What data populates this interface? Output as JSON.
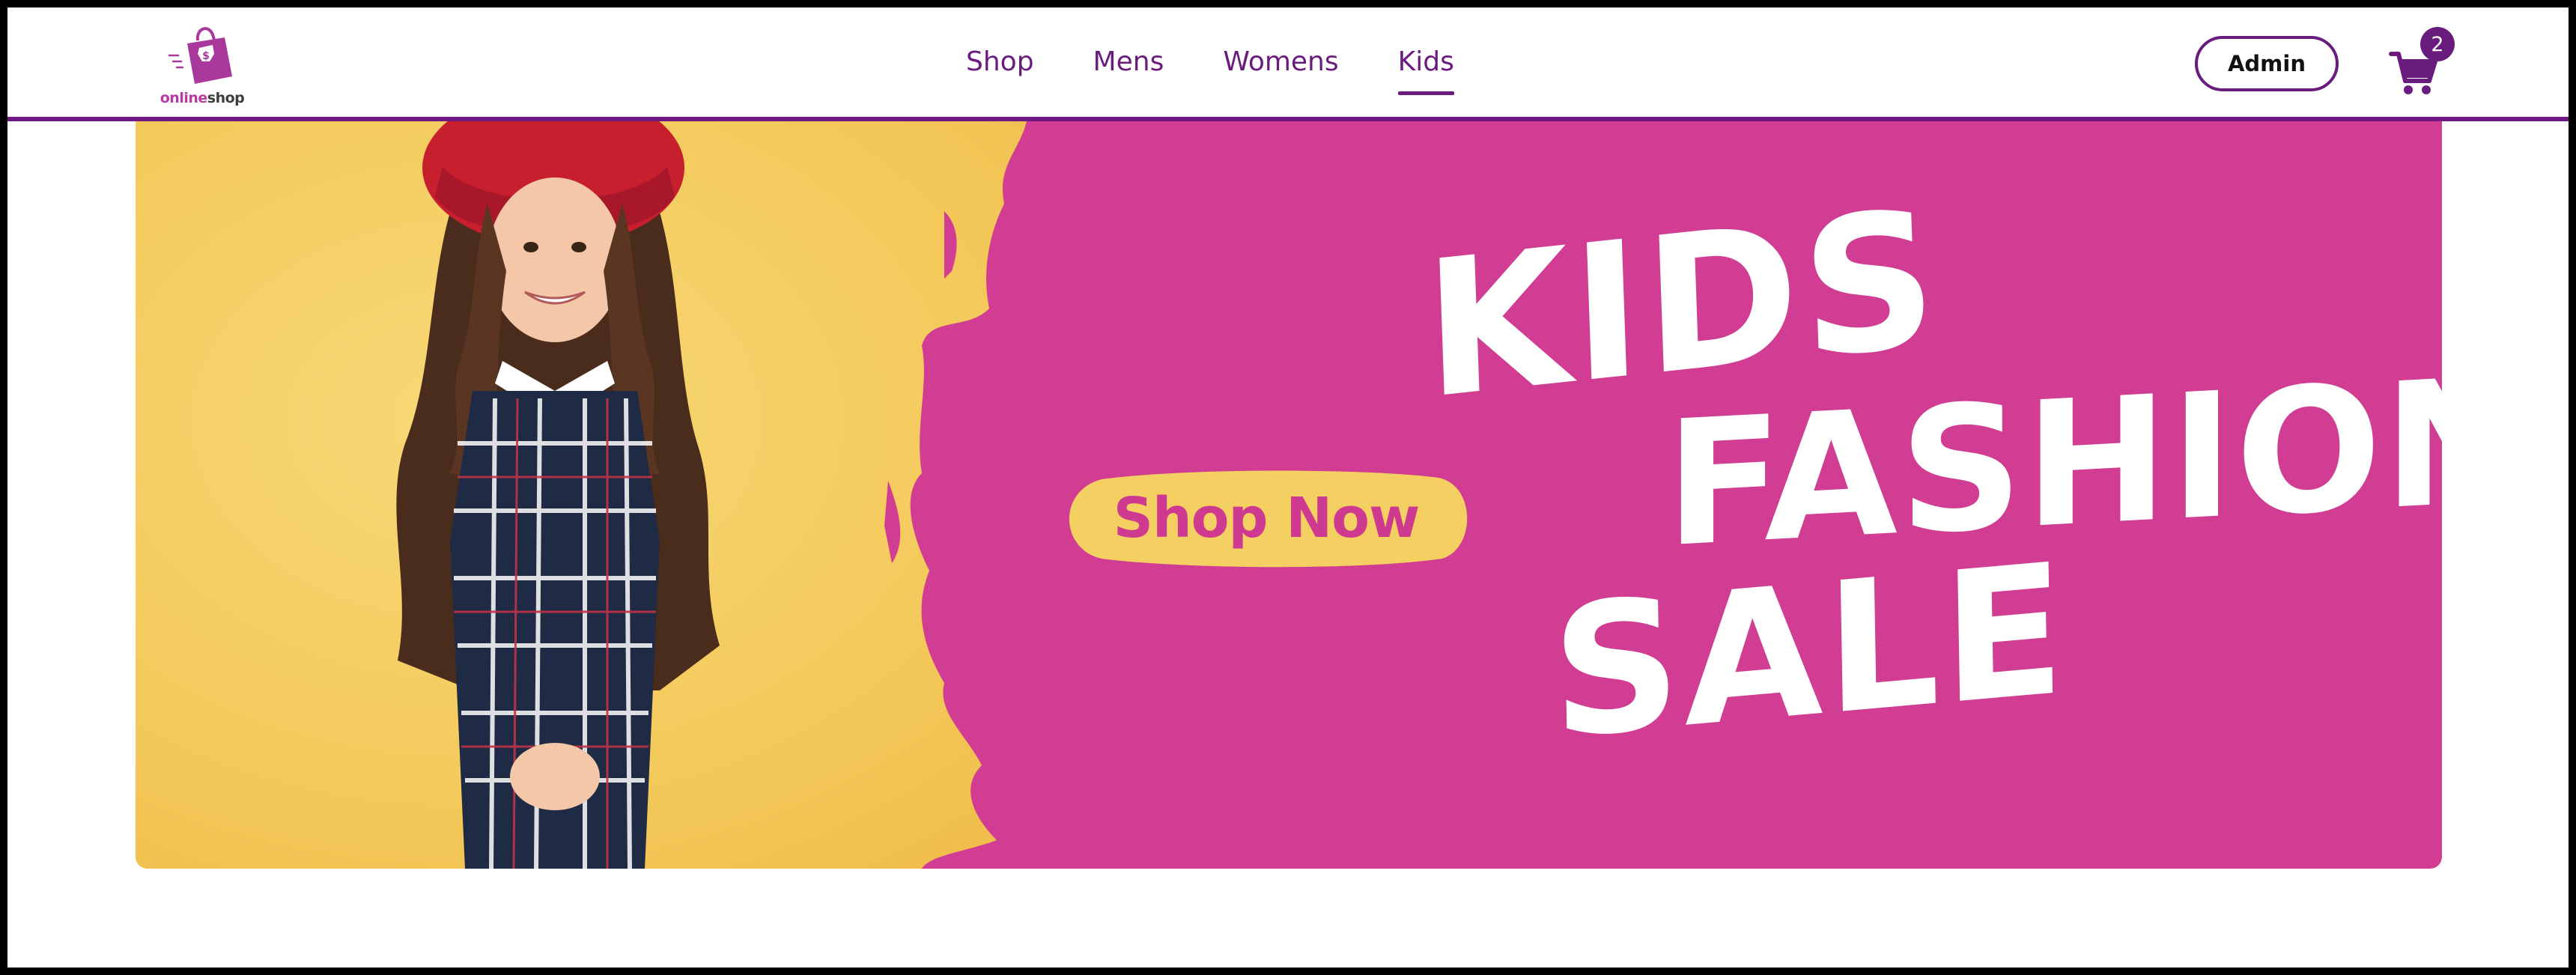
{
  "brand": {
    "name_part1": "online",
    "name_part2": "shop",
    "logo_icon": "shopping-bag-icon",
    "accent_color": "#6a1b7e"
  },
  "nav": {
    "items": [
      {
        "label": "Shop",
        "active": false
      },
      {
        "label": "Mens",
        "active": false
      },
      {
        "label": "Womens",
        "active": false
      },
      {
        "label": "Kids",
        "active": true
      }
    ]
  },
  "header": {
    "admin_label": "Admin",
    "cart_icon": "cart-icon",
    "cart_count": "2"
  },
  "hero": {
    "cta_label": "Shop Now",
    "headline_line1": "KIDS",
    "headline_line2": "FASHION",
    "headline_line3": "SALE",
    "colors": {
      "pink": "#d13d92",
      "yellow": "#f4cf62",
      "headline": "#ffffff"
    }
  }
}
